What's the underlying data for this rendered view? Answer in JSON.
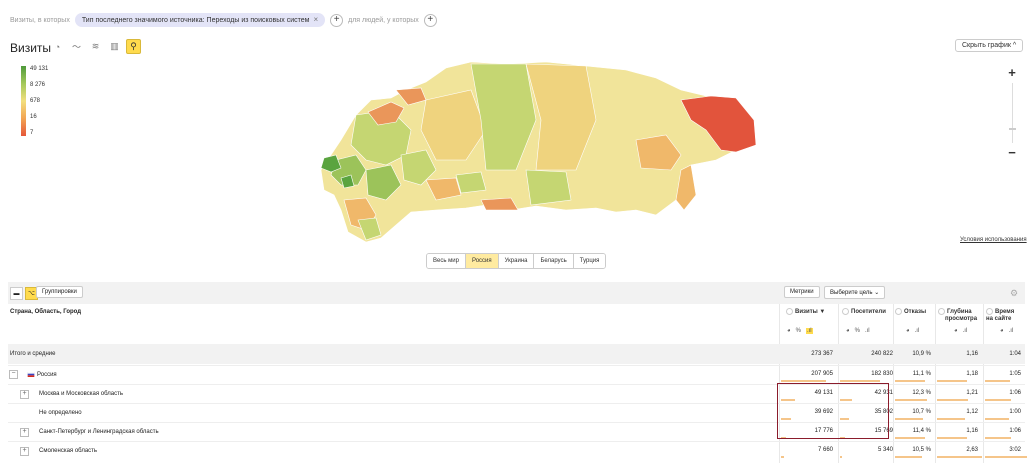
{
  "filters": {
    "prefix": "Визиты, в которых",
    "chip_label": "Тип последнего значимого источника: Переходы из поисковых систем",
    "people_label": "для людей, у которых"
  },
  "header": {
    "title": "Визиты",
    "hide_graph": "Скрыть график ^"
  },
  "legend": {
    "values": [
      "49 131",
      "8 276",
      "678",
      "16",
      "7"
    ]
  },
  "map": {
    "colors": {
      "deep_green": "#5aa43f",
      "green": "#9cc35a",
      "light_green": "#c5d672",
      "pale_yellow": "#f1e49a",
      "yellow": "#efd37e",
      "orange_light": "#f0b86a",
      "orange": "#ea965a",
      "red": "#e2543c"
    },
    "terms": "Условия использования",
    "region_tabs": [
      "Весь мир",
      "Россия",
      "Украина",
      "Беларусь",
      "Турция"
    ],
    "active_tab": "Россия"
  },
  "toolbar": {
    "groupings": "Группировки",
    "metrics": "Метрики",
    "goal": "Выберите цель ⌄"
  },
  "table": {
    "dimension_header": "Страна, Область, Город",
    "columns": [
      {
        "label1": "Визиты ▼",
        "label2": ""
      },
      {
        "label1": "Посетители",
        "label2": ""
      },
      {
        "label1": "Отказы",
        "label2": ""
      },
      {
        "label1": "Глубина",
        "label2": "просмотра"
      },
      {
        "label1": "Время",
        "label2": "на сайте"
      }
    ],
    "rows": [
      {
        "name": "Итого и средние",
        "values": [
          "273 367",
          "240 822",
          "10,9 %",
          "1,16",
          "1:04"
        ]
      },
      {
        "name": "Россия",
        "values": [
          "207 905",
          "182 830",
          "11,1 %",
          "1,18",
          "1:05"
        ]
      },
      {
        "name": "Москва и Московская область",
        "values": [
          "49 131",
          "42 931",
          "12,3 %",
          "1,21",
          "1:06"
        ]
      },
      {
        "name": "Не определено",
        "values": [
          "39 692",
          "35 802",
          "10,7 %",
          "1,12",
          "1:00"
        ]
      },
      {
        "name": "Санкт-Петербург и Ленинградская область",
        "values": [
          "17 776",
          "15 769",
          "11,4 %",
          "1,16",
          "1:06"
        ]
      },
      {
        "name": "Смоленская область",
        "values": [
          "7 660",
          "5 340",
          "10,5 %",
          "2,63",
          "3:02"
        ]
      }
    ]
  }
}
